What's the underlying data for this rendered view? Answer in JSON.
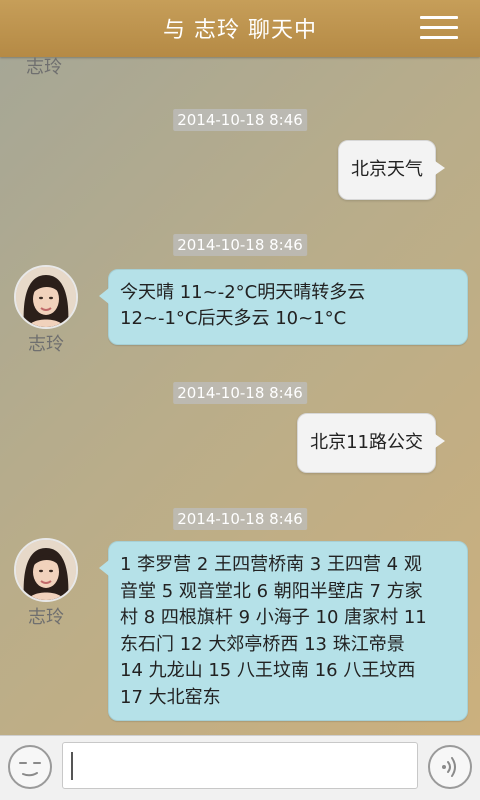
{
  "header": {
    "title": "与 志玲 聊天中",
    "menu_icon": "menu-icon"
  },
  "chat": {
    "top_partial_name": "志玲",
    "messages": [
      {
        "timestamp": "2014-10-18 8:46",
        "direction": "outgoing",
        "text": "北京天气"
      },
      {
        "timestamp": "2014-10-18 8:46",
        "direction": "incoming",
        "sender_name": "志玲",
        "lines": [
          "今天晴 11~-2°C明天晴转多云",
          "12~-1°C后天多云 10~1°C"
        ]
      },
      {
        "timestamp": "2014-10-18 8:46",
        "direction": "outgoing",
        "text": "北京11路公交"
      },
      {
        "timestamp": "2014-10-18 8:46",
        "direction": "incoming",
        "sender_name": "志玲",
        "lines": [
          "1 李罗营 2 王四营桥南 3 王四营 4 观",
          "音堂 5 观音堂北 6 朝阳半壁店 7 方家",
          "村 8 四根旗杆 9 小海子 10 唐家村 11",
          "东石门 12 大郊亭桥西 13 珠江帝景",
          "14 九龙山 15 八王坟南 16 八王坟西",
          "17 大北窑东"
        ]
      }
    ]
  },
  "input_bar": {
    "emoji_icon": "emoji-icon",
    "text_value": "",
    "voice_icon": "voice-icon"
  },
  "colors": {
    "header": "#b58a45",
    "incoming_bubble": "#b5e1e8",
    "outgoing_bubble": "#f3f3f3"
  }
}
